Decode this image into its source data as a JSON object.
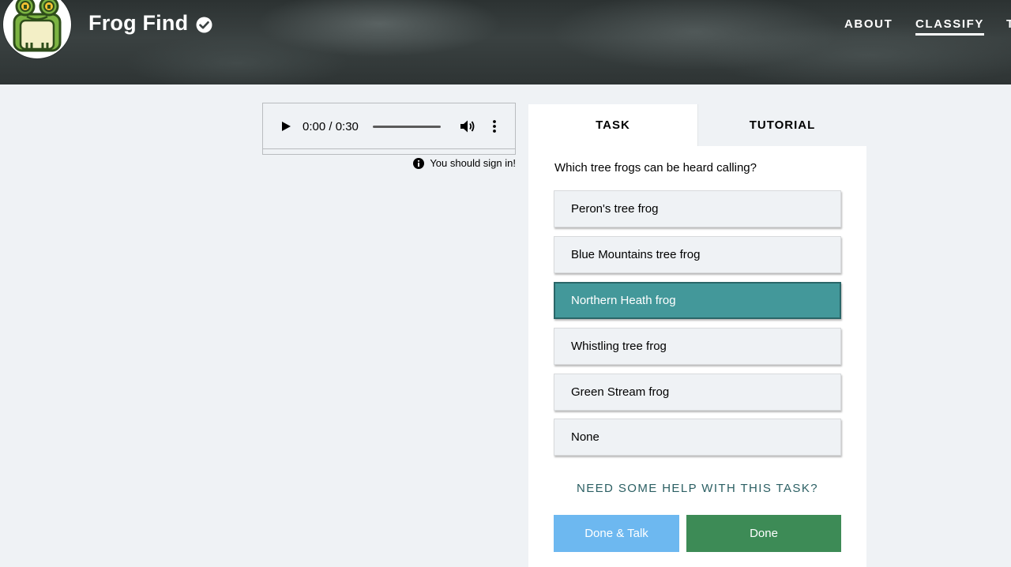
{
  "header": {
    "project_title": "Frog Find",
    "nav": [
      {
        "label": "ABOUT",
        "active": false
      },
      {
        "label": "CLASSIFY",
        "active": true
      },
      {
        "label": "T",
        "active": false
      }
    ]
  },
  "audio": {
    "time": "0:00 / 0:30",
    "signin_note": "You should sign in!"
  },
  "task": {
    "tabs": [
      "TASK",
      "TUTORIAL"
    ],
    "question": "Which tree frogs can be heard calling?",
    "answers": [
      {
        "label": "Peron's tree frog",
        "selected": false
      },
      {
        "label": "Blue Mountains tree frog",
        "selected": false
      },
      {
        "label": "Northern Heath frog",
        "selected": true
      },
      {
        "label": "Whistling tree frog",
        "selected": false
      },
      {
        "label": "Green Stream frog",
        "selected": false
      },
      {
        "label": "None",
        "selected": false
      }
    ],
    "help_link": "NEED SOME HELP WITH THIS TASK?",
    "done_talk_label": "Done & Talk",
    "done_label": "Done"
  },
  "colors": {
    "selected_answer": "#43989a",
    "done_button": "#3d8b56",
    "done_talk_button": "#6db8f0",
    "help_link": "#2b5f63"
  }
}
